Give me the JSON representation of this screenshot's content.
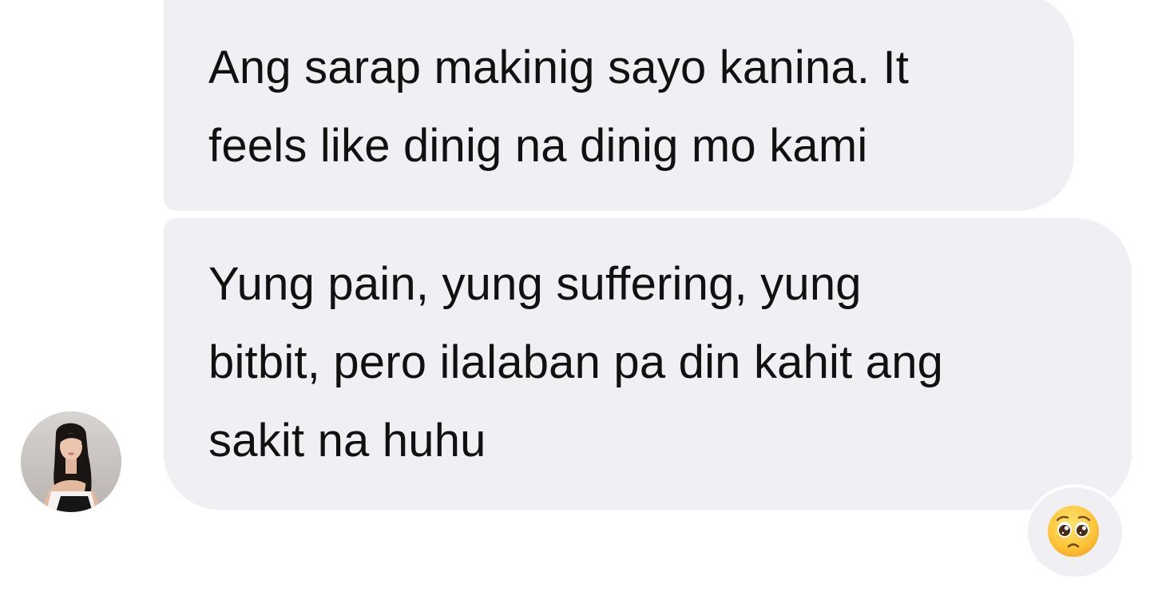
{
  "messages": [
    {
      "lines": [
        "Ang sarap makinig sayo kanina. It",
        "feels like dinig na dinig mo kami"
      ]
    },
    {
      "lines": [
        "Yung pain, yung suffering, yung",
        "bitbit, pero ilalaban pa din kahit ang",
        "sakit na huhu"
      ]
    }
  ],
  "reaction": {
    "icon": "pleading-face-emoji"
  },
  "colors": {
    "bubble_bg": "#efeff4",
    "text": "#111111"
  }
}
